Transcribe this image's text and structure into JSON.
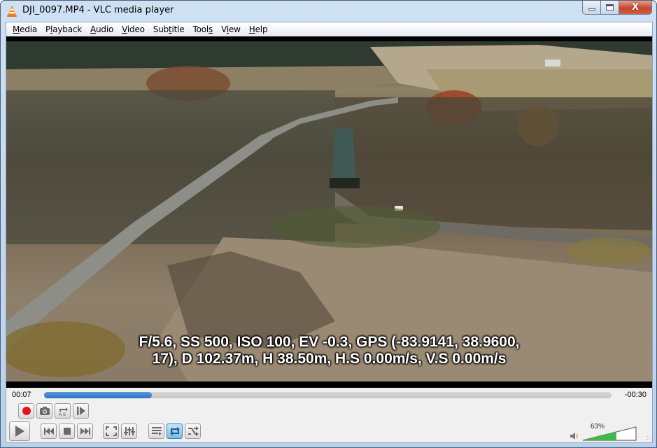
{
  "window": {
    "title": "DJI_0097.MP4 - VLC media player",
    "app_icon": "vlc-cone-icon",
    "controls": {
      "minimize": "minimize-icon",
      "maximize": "maximize-icon",
      "close_glyph": "X"
    }
  },
  "menu": [
    {
      "label": "Media",
      "accel": "M"
    },
    {
      "label": "Playback",
      "accel": "l"
    },
    {
      "label": "Audio",
      "accel": "A"
    },
    {
      "label": "Video",
      "accel": "V"
    },
    {
      "label": "Subtitle",
      "accel": "t"
    },
    {
      "label": "Tools",
      "accel": "s"
    },
    {
      "label": "View",
      "accel": "i"
    },
    {
      "label": "Help",
      "accel": "H"
    }
  ],
  "video": {
    "subtitle_line1": "F/5.6, SS 500, ISO 100, EV -0.3, GPS (-83.9141, 38.9600,",
    "subtitle_line2": "17), D 102.37m, H 38.50m, H.S 0.00m/s, V.S 0.00m/s",
    "scene": "aerial drone footage of autumn countryside with bridge, covered bridge, road and field"
  },
  "playback": {
    "elapsed": "00:07",
    "remaining": "-00:30",
    "progress_fraction": 0.19
  },
  "controls": {
    "row1": [
      {
        "name": "record-button",
        "icon": "record-icon"
      },
      {
        "name": "snapshot-button",
        "icon": "camera-icon"
      },
      {
        "name": "ab-loop-button",
        "icon": "ab-loop-icon"
      },
      {
        "name": "frame-by-frame-button",
        "icon": "frame-step-icon"
      }
    ],
    "row2": [
      {
        "name": "play-button",
        "icon": "play-icon"
      },
      {
        "name": "previous-button",
        "icon": "skip-back-icon"
      },
      {
        "name": "stop-button",
        "icon": "stop-icon"
      },
      {
        "name": "next-button",
        "icon": "skip-forward-icon"
      },
      {
        "name": "fullscreen-button",
        "icon": "fullscreen-icon"
      },
      {
        "name": "extended-settings-button",
        "icon": "equalizer-icon"
      },
      {
        "name": "playlist-button",
        "icon": "playlist-icon"
      },
      {
        "name": "loop-button",
        "icon": "loop-icon",
        "active": true
      },
      {
        "name": "random-button",
        "icon": "shuffle-icon"
      }
    ]
  },
  "volume": {
    "label": "63%",
    "level": 0.63,
    "colors": {
      "fill": "#3dbb48",
      "record": "#e8141c",
      "accent": "#2f73c4"
    }
  }
}
